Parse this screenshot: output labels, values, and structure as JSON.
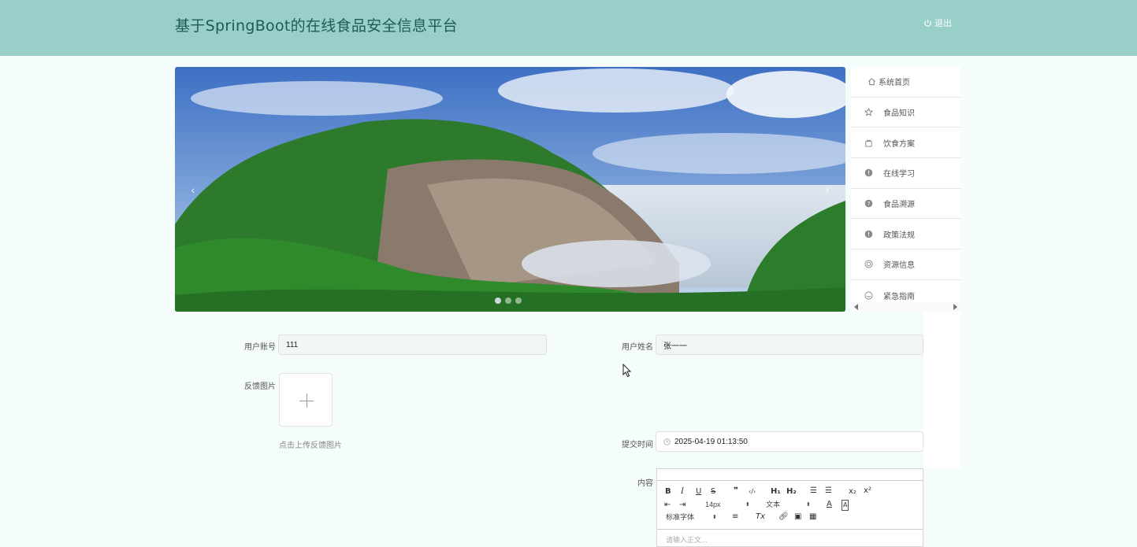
{
  "header": {
    "title": "基于SpringBoot的在线食品安全信息平台",
    "logout_label": "退出"
  },
  "carousel": {
    "prev": "‹",
    "next": "›",
    "slide_count": 3,
    "active_index": 0
  },
  "menu": {
    "items": [
      {
        "label": "系统首页",
        "icon": "home-icon"
      },
      {
        "label": "食品知识",
        "icon": "star-icon"
      },
      {
        "label": "饮食方案",
        "icon": "bag-icon"
      },
      {
        "label": "在线学习",
        "icon": "info-icon"
      },
      {
        "label": "食品溯源",
        "icon": "question-icon"
      },
      {
        "label": "政策法规",
        "icon": "info-icon"
      },
      {
        "label": "资源信息",
        "icon": "target-icon"
      },
      {
        "label": "紧急指南",
        "icon": "smile-icon"
      }
    ]
  },
  "form": {
    "account_label": "用户账号",
    "account_value": "111",
    "name_label": "用户姓名",
    "name_value": "张一一",
    "image_label": "反馈图片",
    "upload_hint": "点击上传反馈图片",
    "time_label": "提交时间",
    "time_value": "2025-04-19 01:13:50",
    "content_label": "内容"
  },
  "editor": {
    "font_size": "14px",
    "block_type": "文本",
    "font_family": "标准字体",
    "placeholder": "请输入正文..."
  },
  "colors": {
    "header_bg": "#98d0c9",
    "title_color": "#1f5a52",
    "page_bg": "#f5fcfc"
  }
}
